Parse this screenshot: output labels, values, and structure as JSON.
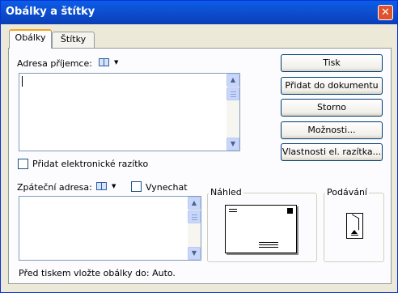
{
  "window": {
    "title": "Obálky a štítky",
    "close_glyph": "✕"
  },
  "tabs": [
    {
      "label": "Obálky",
      "active": true
    },
    {
      "label": "Štítky",
      "active": false
    }
  ],
  "recipient": {
    "label": "Adresa příjemce:",
    "value": ""
  },
  "electronic_stamp": {
    "label": "Přidat elektronické razítko",
    "checked": false
  },
  "return_address": {
    "label": "Zpáteční adresa:",
    "value": ""
  },
  "omit": {
    "label": "Vynechat",
    "checked": false
  },
  "buttons": [
    {
      "label": "Tisk"
    },
    {
      "label": "Přidat do dokumentu"
    },
    {
      "label": "Storno"
    },
    {
      "label": "Možnosti..."
    },
    {
      "label": "Vlastnosti el. razítka..."
    }
  ],
  "preview": {
    "title": "Náhled"
  },
  "feed": {
    "title": "Podávání"
  },
  "status_text": "Před tiskem vložte obálky do: Auto.",
  "colors": {
    "titlebar": "#0a5ee8",
    "dialog_bg": "#ece9d8",
    "panel_bg": "#fcfcfe",
    "close": "#e0522e"
  }
}
